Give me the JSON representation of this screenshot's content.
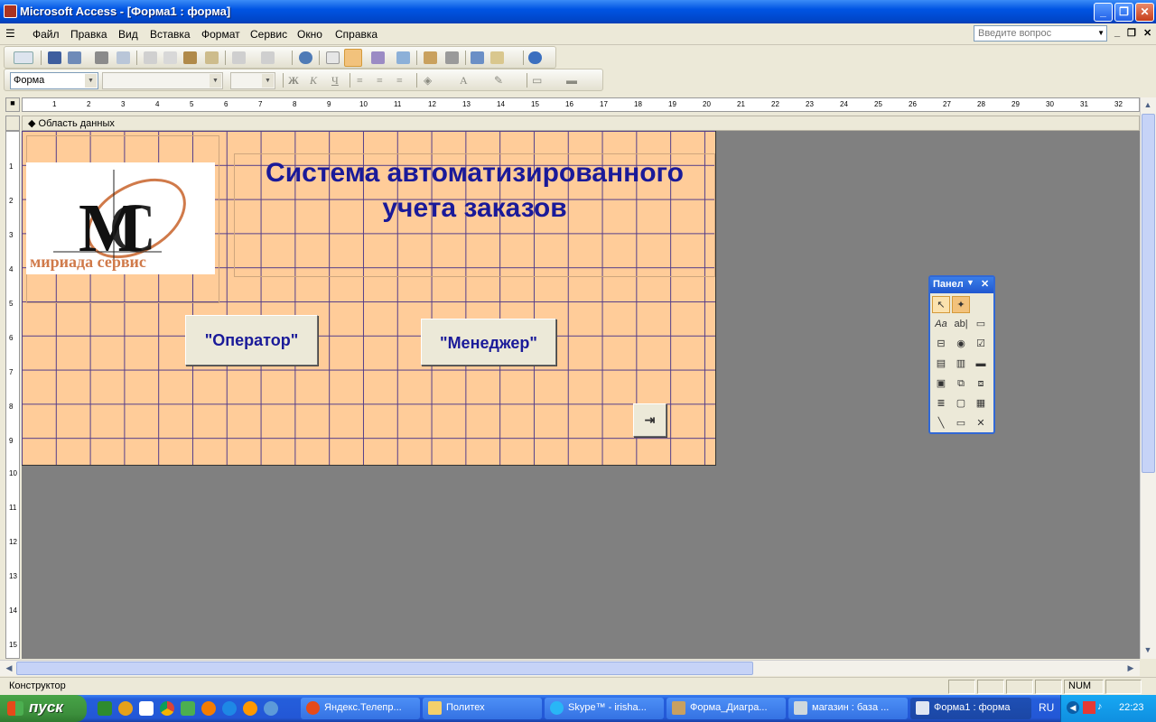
{
  "window": {
    "title": "Microsoft Access - [Форма1 : форма]"
  },
  "menu": [
    "Файл",
    "Правка",
    "Вид",
    "Вставка",
    "Формат",
    "Сервис",
    "Окно",
    "Справка"
  ],
  "ask": {
    "placeholder": "Введите вопрос"
  },
  "format_toolbar": {
    "object_combo": "Форма",
    "bold": "Ж",
    "italic": "К",
    "underline": "Ч"
  },
  "ruler": {
    "h": [
      "1",
      "2",
      "3",
      "4",
      "5",
      "6",
      "7",
      "8",
      "9",
      "10",
      "11",
      "12",
      "13",
      "14",
      "15",
      "16",
      "17",
      "18",
      "19",
      "20",
      "21",
      "22",
      "23",
      "24",
      "25",
      "26",
      "27",
      "28",
      "29",
      "30",
      "31",
      "32"
    ],
    "v": [
      "1",
      "2",
      "3",
      "4",
      "5",
      "6",
      "7",
      "8",
      "9",
      "10",
      "11",
      "12",
      "13",
      "14",
      "15"
    ]
  },
  "section": {
    "label": "Область данных"
  },
  "form": {
    "title": "Система автоматизированного учета заказов",
    "logo_text": "мириада сервис",
    "operator_button": "\"Оператор\"",
    "manager_button": "\"Менеджер\""
  },
  "toolbox": {
    "title": "Панел"
  },
  "status": {
    "mode": "Конструктор",
    "num": "NUM"
  },
  "taskbar": {
    "start": "пуск",
    "tasks": [
      "Яндекс.Телепр...",
      "Политех",
      "Skype™ - irisha...",
      "Форма_Диагра...",
      "магазин : база ...",
      "Форма1 : форма"
    ],
    "lang": "RU",
    "clock": "22:23"
  }
}
